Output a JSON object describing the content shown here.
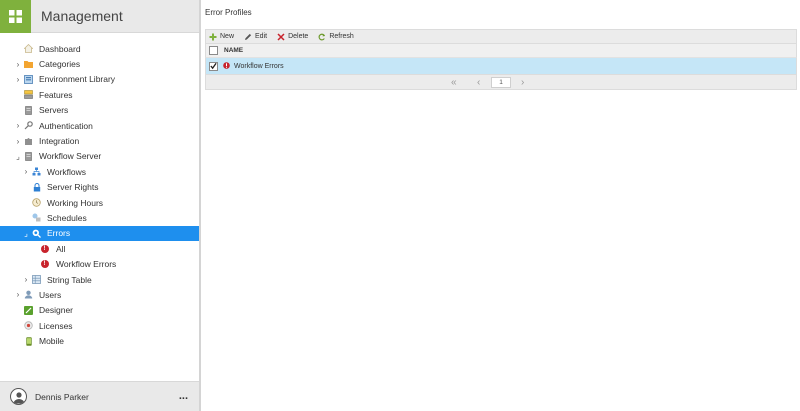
{
  "app": {
    "title": "Management"
  },
  "nav": {
    "items": [
      {
        "label": "Dashboard"
      },
      {
        "label": "Categories"
      },
      {
        "label": "Environment Library"
      },
      {
        "label": "Features"
      },
      {
        "label": "Servers"
      },
      {
        "label": "Authentication"
      },
      {
        "label": "Integration"
      },
      {
        "label": "Workflow Server"
      },
      {
        "label": "Workflows"
      },
      {
        "label": "Server Rights"
      },
      {
        "label": "Working Hours"
      },
      {
        "label": "Schedules"
      },
      {
        "label": "Errors"
      },
      {
        "label": "All"
      },
      {
        "label": "Workflow Errors"
      },
      {
        "label": "String Table"
      },
      {
        "label": "Users"
      },
      {
        "label": "Designer"
      },
      {
        "label": "Licenses"
      },
      {
        "label": "Mobile"
      }
    ]
  },
  "user": {
    "name": "Dennis Parker",
    "more": "..."
  },
  "main": {
    "title": "Error Profiles",
    "toolbar": {
      "new": "New",
      "edit": "Edit",
      "delete": "Delete",
      "refresh": "Refresh"
    },
    "grid": {
      "column": "NAME",
      "rows": [
        {
          "name": "Workflow Errors",
          "checked": true
        }
      ]
    },
    "pager": {
      "page": "1"
    }
  },
  "colors": {
    "accent": "#1e8fee",
    "logo": "#7fb13d",
    "row_selected": "#c5e6f7",
    "error": "#c8232c"
  }
}
